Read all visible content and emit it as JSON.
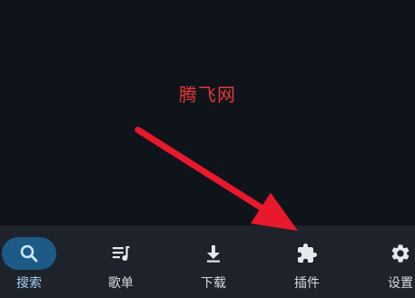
{
  "watermark": {
    "text": "腾飞网"
  },
  "colors": {
    "background": "#0f131a",
    "nav_background": "#1d222b",
    "active_pill": "#1d5a86",
    "watermark": "#e53935",
    "arrow": "#e8192c"
  },
  "bottom_nav": {
    "items": [
      {
        "label": "搜索",
        "icon": "search-icon",
        "active": true
      },
      {
        "label": "歌单",
        "icon": "playlist-icon",
        "active": false
      },
      {
        "label": "下载",
        "icon": "download-icon",
        "active": false
      },
      {
        "label": "插件",
        "icon": "puzzle-icon",
        "active": false
      },
      {
        "label": "设置",
        "icon": "gear-icon",
        "active": false
      }
    ]
  }
}
